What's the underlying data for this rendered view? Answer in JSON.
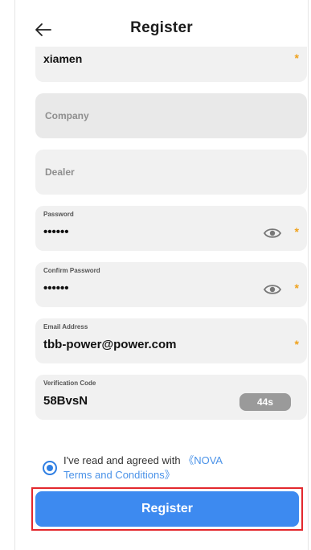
{
  "header": {
    "title": "Register"
  },
  "fields": {
    "city": {
      "value": "xiamen",
      "required": "*"
    },
    "company": {
      "placeholder": "Company"
    },
    "dealer": {
      "placeholder": "Dealer"
    },
    "password": {
      "label": "Password",
      "value": "••••••",
      "required": "*"
    },
    "confirm_password": {
      "label": "Confirm Password",
      "value": "••••••",
      "required": "*"
    },
    "email": {
      "label": "Email Address",
      "value": "tbb-power@power.com",
      "required": "*"
    },
    "verification": {
      "label": "Verification Code",
      "value": "58BvsN",
      "countdown": "44s"
    }
  },
  "agreement": {
    "text": "I've read and agreed with ",
    "link_part1": "《NOVA",
    "link_part2": "Terms and Conditions》",
    "checked": true
  },
  "register_button": {
    "label": "Register"
  },
  "colors": {
    "accent": "#3d8af0",
    "required": "#f0a21c",
    "highlight_border": "#e3282d"
  },
  "icons": {
    "back": "arrow-left-icon",
    "eye": "eye-icon"
  }
}
